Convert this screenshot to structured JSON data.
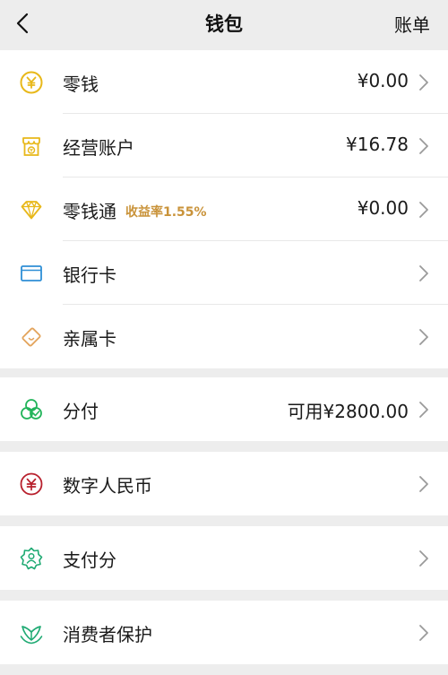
{
  "header": {
    "title": "钱包",
    "bill_label": "账单"
  },
  "group1": {
    "items": [
      {
        "label": "零钱",
        "value": "¥0.00",
        "icon": "coin-yuan-icon",
        "color": "#e8b81a"
      },
      {
        "label": "经营账户",
        "value": "¥16.78",
        "icon": "shop-account-icon",
        "color": "#e8b81a"
      },
      {
        "label": "零钱通",
        "sub": "收益率1.55%",
        "value": "¥0.00",
        "icon": "diamond-icon",
        "color": "#e8b81a"
      },
      {
        "label": "银行卡",
        "value": "",
        "icon": "bank-card-icon",
        "color": "#2e8fd6"
      },
      {
        "label": "亲属卡",
        "value": "",
        "icon": "family-card-icon",
        "color": "#e3a45c"
      }
    ]
  },
  "group2": {
    "items": [
      {
        "label": "分付",
        "value": "可用¥2800.00",
        "icon": "fenfu-icon",
        "color": "#22b45a"
      }
    ]
  },
  "group3": {
    "items": [
      {
        "label": "数字人民币",
        "value": "",
        "icon": "digital-rmb-icon",
        "color": "#b8202d"
      }
    ]
  },
  "group4": {
    "items": [
      {
        "label": "支付分",
        "value": "",
        "icon": "pay-score-icon",
        "color": "#1faa73"
      }
    ]
  },
  "group5": {
    "items": [
      {
        "label": "消费者保护",
        "value": "",
        "icon": "consumer-protection-icon",
        "color": "#1faa73"
      }
    ]
  }
}
